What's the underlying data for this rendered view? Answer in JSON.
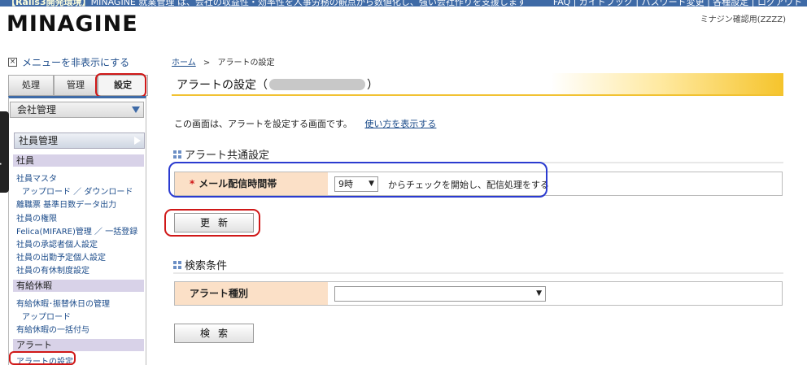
{
  "header": {
    "env_label": "【Rails3開発環境】",
    "tagline": "MINAGINE 就業管理 は、会社の収益性・効率性を人事労務の観点から数値化し、強い会社作りを支援します",
    "links": [
      "FAQ",
      "ガイドブック",
      "パスワード変更",
      "各種設定",
      "ログアウト"
    ],
    "logo": "MINAGINE",
    "company": "ミナジン確認用(ZZZZ)",
    "colors": {
      "topbar": "#3e6aa6",
      "accent": "#f5c42c",
      "annotation_red": "#d01818",
      "annotation_blue": "#2b3bd0"
    }
  },
  "sidebar": {
    "hide_menu": "メニューを非表示にする",
    "hide_icon": "close-box-icon",
    "tabs": [
      "処理",
      "管理",
      "設定"
    ],
    "active_tab": "設定",
    "support_label": "support",
    "company_dropdown": "会社管理",
    "employee_dropdown": "社員管理",
    "sections": [
      {
        "title": "社員",
        "items": [
          {
            "label": "社員マスタ",
            "indent": false
          },
          {
            "label": "アップロード ／ ダウンロード",
            "indent": true
          },
          {
            "label": "離職票 基準日数データ出力",
            "indent": false
          },
          {
            "label": "社員の権限",
            "indent": false
          },
          {
            "label": "Felica(MIFARE)管理 ／ 一括登録",
            "indent": false
          },
          {
            "label": "社員の承認者個人設定",
            "indent": false
          },
          {
            "label": "社員の出勤予定個人設定",
            "indent": false
          },
          {
            "label": "社員の有休制度設定",
            "indent": false
          }
        ]
      },
      {
        "title": "有給休暇",
        "items": [
          {
            "label": "有給休暇･振替休日の管理",
            "indent": false
          },
          {
            "label": "アップロード",
            "indent": true
          },
          {
            "label": "有給休暇の一括付与",
            "indent": false
          }
        ]
      },
      {
        "title": "アラート",
        "items": [
          {
            "label": "アラートの設定",
            "indent": false
          }
        ]
      }
    ]
  },
  "main": {
    "breadcrumb": {
      "home": "ホーム",
      "sep": ">",
      "current": "アラートの設定"
    },
    "title_prefix": "アラートの設定（",
    "title_suffix": "）",
    "intro": "この画面は、アラートを設定する画面です。",
    "help_link": "使い方を表示する",
    "common": {
      "heading": "アラート共通設定",
      "field_label": "メール配信時間帯",
      "required_mark": "*",
      "selected": "9時",
      "suffix": "からチェックを開始し、配信処理をする",
      "update_button": "更新"
    },
    "search": {
      "heading": "検索条件",
      "field_label": "アラート種別",
      "selected": "",
      "search_button": "検索"
    }
  }
}
